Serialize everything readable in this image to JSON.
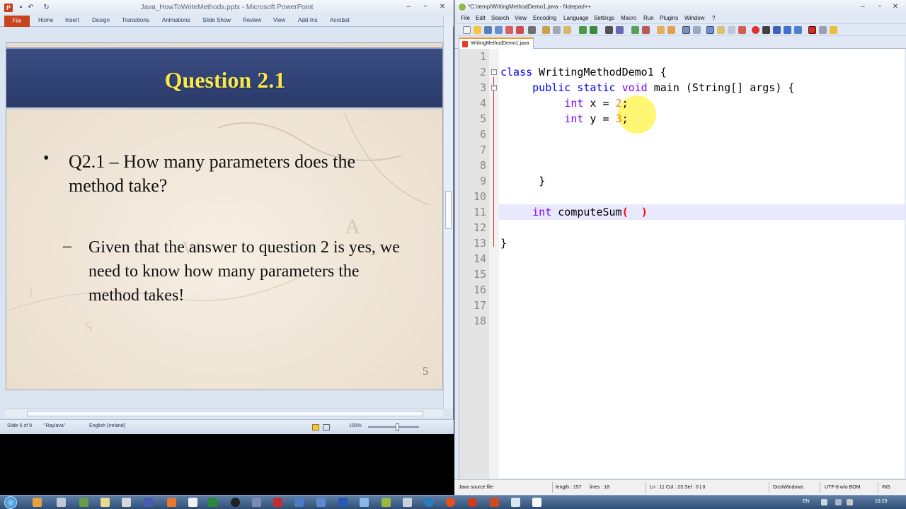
{
  "powerpoint": {
    "window_title": "Java_HowToWriteMethods.pptx - Microsoft PowerPoint",
    "ribbon_tabs": [
      "File",
      "Home",
      "Insert",
      "Design",
      "Transitions",
      "Animations",
      "Slide Show",
      "Review",
      "View",
      "Add-Ins",
      "Acrobat"
    ],
    "slide": {
      "title": "Question 2.1",
      "bullet_marker": "•",
      "bullet1": "Q2.1 – How many parameters does the method take?",
      "sub_marker": "–",
      "bullet2": "Given that the answer to question 2 is yes, we need to know how many parameters the method takes!",
      "page_number": "5"
    },
    "status": {
      "slide_info": "Slide 5 of 9",
      "theme": "\"Raylava\"",
      "language": "English (Ireland)",
      "zoom": "100%"
    }
  },
  "notepadpp": {
    "window_title": "*C:\\temp\\WritingMethodDemo1.java - Notepad++",
    "menu": [
      "File",
      "Edit",
      "Search",
      "View",
      "Encoding",
      "Language",
      "Settings",
      "Macro",
      "Run",
      "Plugins",
      "Window",
      "?"
    ],
    "tab_label": "WritingMethodDemo1.java",
    "line_numbers": [
      "1",
      "2",
      "3",
      "4",
      "5",
      "6",
      "7",
      "8",
      "9",
      "10",
      "11",
      "12",
      "13",
      "14",
      "15",
      "16",
      "17",
      "18"
    ],
    "code": {
      "l2_kw": "class",
      "l2_rest": " WritingMethodDemo1 {",
      "l3_kw": "public static",
      "l3_kw2": "void",
      "l3_rest": " main (String[] args) {",
      "l4_type": "int",
      "l4_rest": " x = ",
      "l4_num": "2",
      "l4_end": ";",
      "l5_type": "int",
      "l5_rest": " y = ",
      "l5_num": "3",
      "l5_end": ";",
      "l9": "}",
      "l11_type": "int",
      "l11_rest": " computeSum",
      "l11_open": "(",
      "l11_close": ")",
      "l13": "}"
    },
    "status": {
      "file_type": "Java source file",
      "length": "length : 157",
      "lines": "lines : 18",
      "position": "Ln : 11   Col : 23   Sel : 0 | 0",
      "eol": "Dos\\Windows",
      "encoding": "UTF-8 w/o BOM",
      "mode": "INS"
    }
  },
  "taskbar": {
    "language": "EN",
    "time": "19:29"
  }
}
